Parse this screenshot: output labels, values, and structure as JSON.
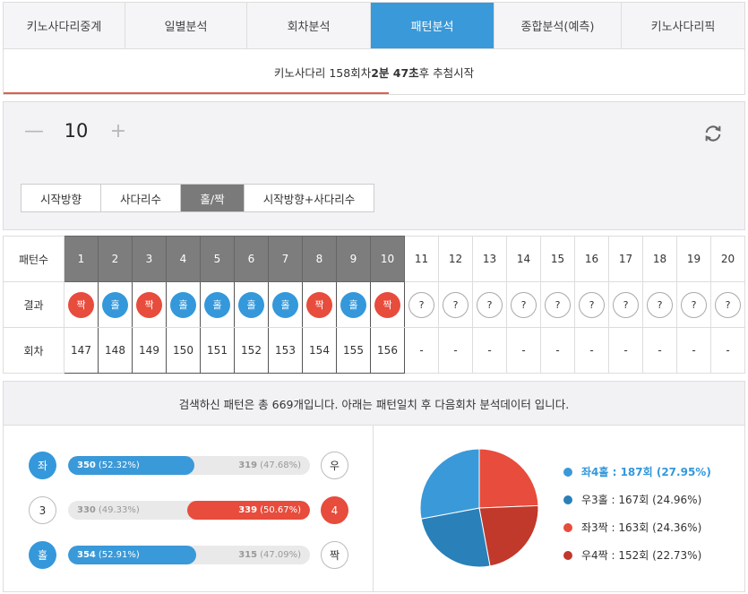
{
  "nav": {
    "tabs": [
      {
        "label": "키노사다리중계"
      },
      {
        "label": "일별분석"
      },
      {
        "label": "회차분석"
      },
      {
        "label": "패턴분석",
        "active": true
      },
      {
        "label": "종합분석(예측)"
      },
      {
        "label": "키노사다리픽"
      }
    ]
  },
  "countdown": {
    "prefix": "키노사다리 158회차 ",
    "minutes": "2분 47초",
    "suffix": "후 추첨시작",
    "progress": 0.52
  },
  "stepper": {
    "minus": "—",
    "value": "10",
    "plus": "+"
  },
  "filters": [
    {
      "label": "시작방향"
    },
    {
      "label": "사다리수"
    },
    {
      "label": "홀/짝",
      "active": true
    },
    {
      "label": "시작방향+사다리수"
    }
  ],
  "table": {
    "header_label": "패턴수",
    "result_label": "결과",
    "round_label": "회차",
    "columns": [
      "1",
      "2",
      "3",
      "4",
      "5",
      "6",
      "7",
      "8",
      "9",
      "10",
      "11",
      "12",
      "13",
      "14",
      "15",
      "16",
      "17",
      "18",
      "19",
      "20"
    ],
    "active_count": 10,
    "results": [
      "짝",
      "홀",
      "짝",
      "홀",
      "홀",
      "홀",
      "홀",
      "짝",
      "홀",
      "짝",
      "?",
      "?",
      "?",
      "?",
      "?",
      "?",
      "?",
      "?",
      "?",
      "?"
    ],
    "rounds": [
      "147",
      "148",
      "149",
      "150",
      "151",
      "152",
      "153",
      "154",
      "155",
      "156",
      "-",
      "-",
      "-",
      "-",
      "-",
      "-",
      "-",
      "-",
      "-",
      "-"
    ]
  },
  "summary": {
    "text": "검색하신 패턴은 총 669개입니다. 아래는 패턴일치 후 다음회차 분석데이터 입니다."
  },
  "stats": [
    {
      "left_label": "좌",
      "right_label": "우",
      "left_count": "350",
      "left_pct": "(52.32%)",
      "right_count": "319",
      "right_pct": "(47.68%)",
      "winner": "left",
      "fill": 0.5232
    },
    {
      "left_label": "3",
      "right_label": "4",
      "left_count": "330",
      "left_pct": "(49.33%)",
      "right_count": "339",
      "right_pct": "(50.67%)",
      "winner": "right",
      "fill": 0.5067
    },
    {
      "left_label": "홀",
      "right_label": "짝",
      "left_count": "354",
      "left_pct": "(52.91%)",
      "right_count": "315",
      "right_pct": "(47.09%)",
      "winner": "left",
      "fill": 0.5291
    }
  ],
  "colors": {
    "blue": "#3498db",
    "red": "#e74c3c",
    "dark_blue": "#2a80b9",
    "dark_red": "#c0392b"
  },
  "chart_data": {
    "type": "pie",
    "slices": [
      {
        "label": "좌4홀 : 187회 (27.95%)",
        "value": 187,
        "color": "#3a99d8",
        "highlight": true
      },
      {
        "label": "우3홀 : 167회 (24.96%)",
        "value": 167,
        "color": "#2a80b9"
      },
      {
        "label": "좌3짝 : 163회 (24.36%)",
        "value": 163,
        "color": "#e74c3c"
      },
      {
        "label": "우4짝 : 152회 (22.73%)",
        "value": 152,
        "color": "#c0392b"
      }
    ]
  }
}
